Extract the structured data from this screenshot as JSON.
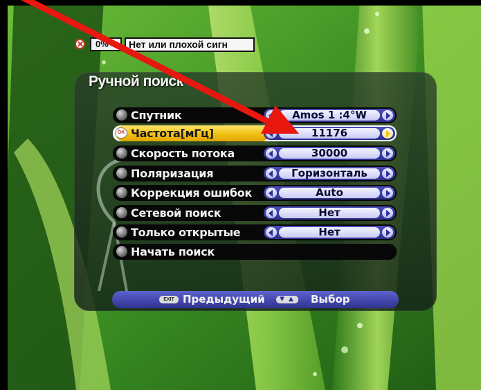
{
  "status": {
    "icon": "no-signal-icon",
    "signal_label": "0%",
    "message": "Нет или плохой сигн"
  },
  "menu": {
    "title": "Ручной поиск",
    "items": [
      {
        "label": "Спутник",
        "value": "Amos 1 :4°W"
      },
      {
        "label": "Частота[мГц]",
        "value": "11176",
        "selected": true
      },
      {
        "label": "Скорость потока",
        "value": "30000"
      },
      {
        "label": "Поляризация",
        "value": "Горизонталь"
      },
      {
        "label": "Коррекция ошибок",
        "value": "Auto"
      },
      {
        "label": "Сетевой поиск",
        "value": "Нет"
      },
      {
        "label": "Только открытые",
        "value": "Нет"
      },
      {
        "label": "Начать поиск"
      }
    ]
  },
  "help": {
    "exit_key": "EXIT",
    "prev_label": "Предыдущий",
    "select_label": "Выбор"
  },
  "colors": {
    "highlight": "#f2c419",
    "value_field": "#2d2f8e",
    "annotation_arrow": "#e8170f"
  }
}
